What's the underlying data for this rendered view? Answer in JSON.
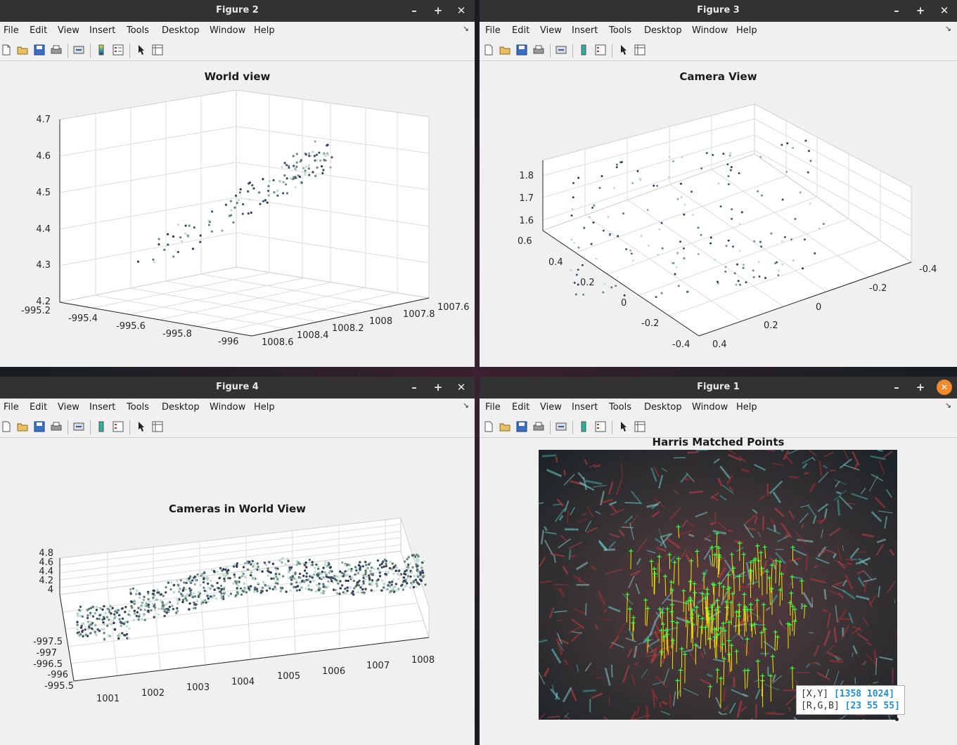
{
  "menu": [
    "File",
    "Edit",
    "View",
    "Insert",
    "Tools",
    "Desktop",
    "Window",
    "Help"
  ],
  "window_controls": {
    "minimize": "–",
    "maximize": "+",
    "close": "✕"
  },
  "toolbar_icons": [
    "new-figure-icon",
    "open-file-icon",
    "save-icon",
    "print-icon",
    "link-plot-icon",
    "insert-colorbar-icon",
    "insert-legend-icon",
    "edit-plot-icon",
    "property-inspector-icon"
  ],
  "figure2": {
    "window_title": "Figure 2",
    "plot_title": "World view",
    "z_ticks": [
      "4.7",
      "4.6",
      "4.5",
      "4.4",
      "4.3",
      "4.2"
    ],
    "x_ticks": [
      "-995.2",
      "-995.4",
      "-995.6",
      "-995.8",
      "-996"
    ],
    "y_ticks": [
      "1008.6",
      "1008.4",
      "1008.2",
      "1008",
      "1007.8",
      "1007.6"
    ]
  },
  "figure3": {
    "window_title": "Figure 3",
    "plot_title": "Camera View",
    "z_ticks": [
      "1.8",
      "1.7",
      "1.6"
    ],
    "x_ticks": [
      "0.6",
      "0.4",
      "0.2",
      "0",
      "-0.2",
      "-0.4"
    ],
    "y_ticks": [
      "0.4",
      "0.2",
      "0",
      "-0.2",
      "-0.4"
    ]
  },
  "figure4": {
    "window_title": "Figure 4",
    "plot_title": "Cameras in World View",
    "z_ticks": [
      "4.8",
      "4.6",
      "4.4",
      "4.2",
      "4"
    ],
    "y_ticks": [
      "-997.5",
      "-997",
      "-996.5",
      "-996",
      "-995.5"
    ],
    "x_ticks": [
      "1001",
      "1002",
      "1003",
      "1004",
      "1005",
      "1006",
      "1007",
      "1008"
    ]
  },
  "figure1": {
    "window_title": "Figure 1",
    "plot_title": "Harris Matched Points",
    "datatip": {
      "line1_label": "[X,Y]",
      "line1_value": "[1358 1024]",
      "line2_label": "[R,G,B]",
      "line2_value": "[23 55 55]"
    }
  },
  "colors": {
    "titlebar": "#323232",
    "window_bg": "#f0f0f0",
    "close_active": "#f0882c",
    "datatip_value": "#1e90d6",
    "match_lines": "#f5e400",
    "match_points": "#38ff38"
  }
}
